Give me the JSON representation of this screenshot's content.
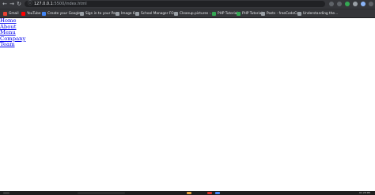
{
  "browser": {
    "url_host": "127.0.0.1",
    "url_path": ":5500/index.html",
    "bookmarks": [
      {
        "label": "Gmail",
        "color": "#ea4335"
      },
      {
        "label": "YouTube",
        "color": "#ff0000"
      },
      {
        "label": "Create your Google...",
        "color": "#4285f4"
      },
      {
        "label": "Sign in to your Pa...",
        "color": "#9aa0a6"
      },
      {
        "label": "Image 6",
        "color": "#9aa0a6"
      },
      {
        "label": "School Manager FO...",
        "color": "#9aa0a6"
      },
      {
        "label": "Cleanup.pictures -...",
        "color": "#9aa0a6"
      },
      {
        "label": "PHP Tutorial",
        "color": "#34a853"
      },
      {
        "label": "PHP Tutorial",
        "color": "#34a853"
      },
      {
        "label": "Posts - freeCodeCa...",
        "color": "#9aa0a6"
      },
      {
        "label": "Understanding the...",
        "color": "#9aa0a6"
      }
    ]
  },
  "nav": {
    "links": [
      "Home",
      "About",
      "Menu",
      "Company",
      "Team"
    ]
  },
  "taskbar": {
    "clock": "01:28 PM"
  }
}
